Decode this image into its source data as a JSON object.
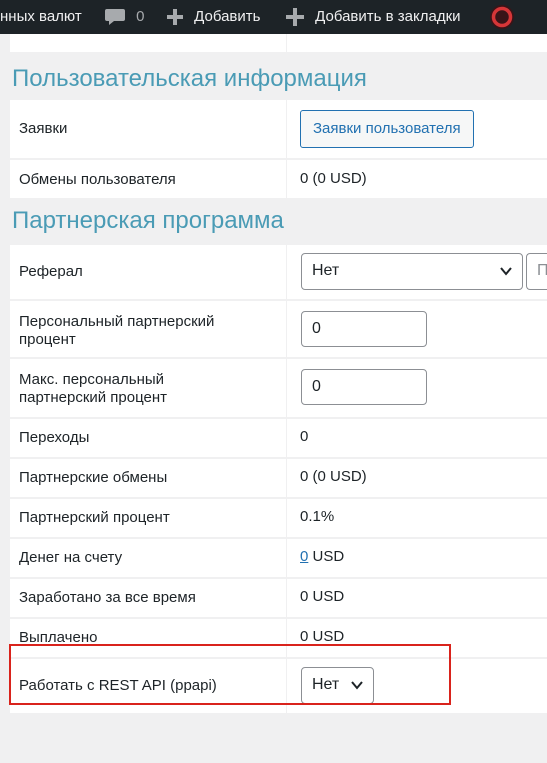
{
  "adminbar": {
    "currency_item": "нных валют",
    "comments_count": "0",
    "add_label": "Добавить",
    "bookmark_label": "Добавить в закладки"
  },
  "sections": {
    "user_info_title": "Пользовательская информация",
    "partner_title": "Партнерская программа"
  },
  "user_info": {
    "requests_label": "Заявки",
    "requests_button": "Заявки пользователя",
    "exchanges_label": "Обмены пользователя",
    "exchanges_value": "0 (0 USD)"
  },
  "partner": {
    "referral_label": "Реферал",
    "referral_value": "Нет",
    "referral_extra": "П",
    "personal_percent_label": "Персональный партнерский процент",
    "personal_percent_value": "0",
    "max_percent_label": "Макс. персональный партнерский процент",
    "max_percent_value": "0",
    "clicks_label": "Переходы",
    "clicks_value": "0",
    "partner_exchanges_label": "Партнерские обмены",
    "partner_exchanges_value": "0 (0 USD)",
    "partner_percent_label": "Партнерский процент",
    "partner_percent_value": "0.1%",
    "balance_label": "Денег на счету",
    "balance_amount": "0",
    "balance_currency": "USD",
    "earned_label": "Заработано за все время",
    "earned_value": "0 USD",
    "paid_label": "Выплачено",
    "paid_value": "0 USD",
    "rest_api_label": "Работать с REST API (ppapi)",
    "rest_api_value": "Нет"
  },
  "colors": {
    "adminbar_bg": "#1d2327",
    "section_title": "#4a9bb5",
    "link": "#2271b1",
    "highlight": "#d9231c"
  }
}
